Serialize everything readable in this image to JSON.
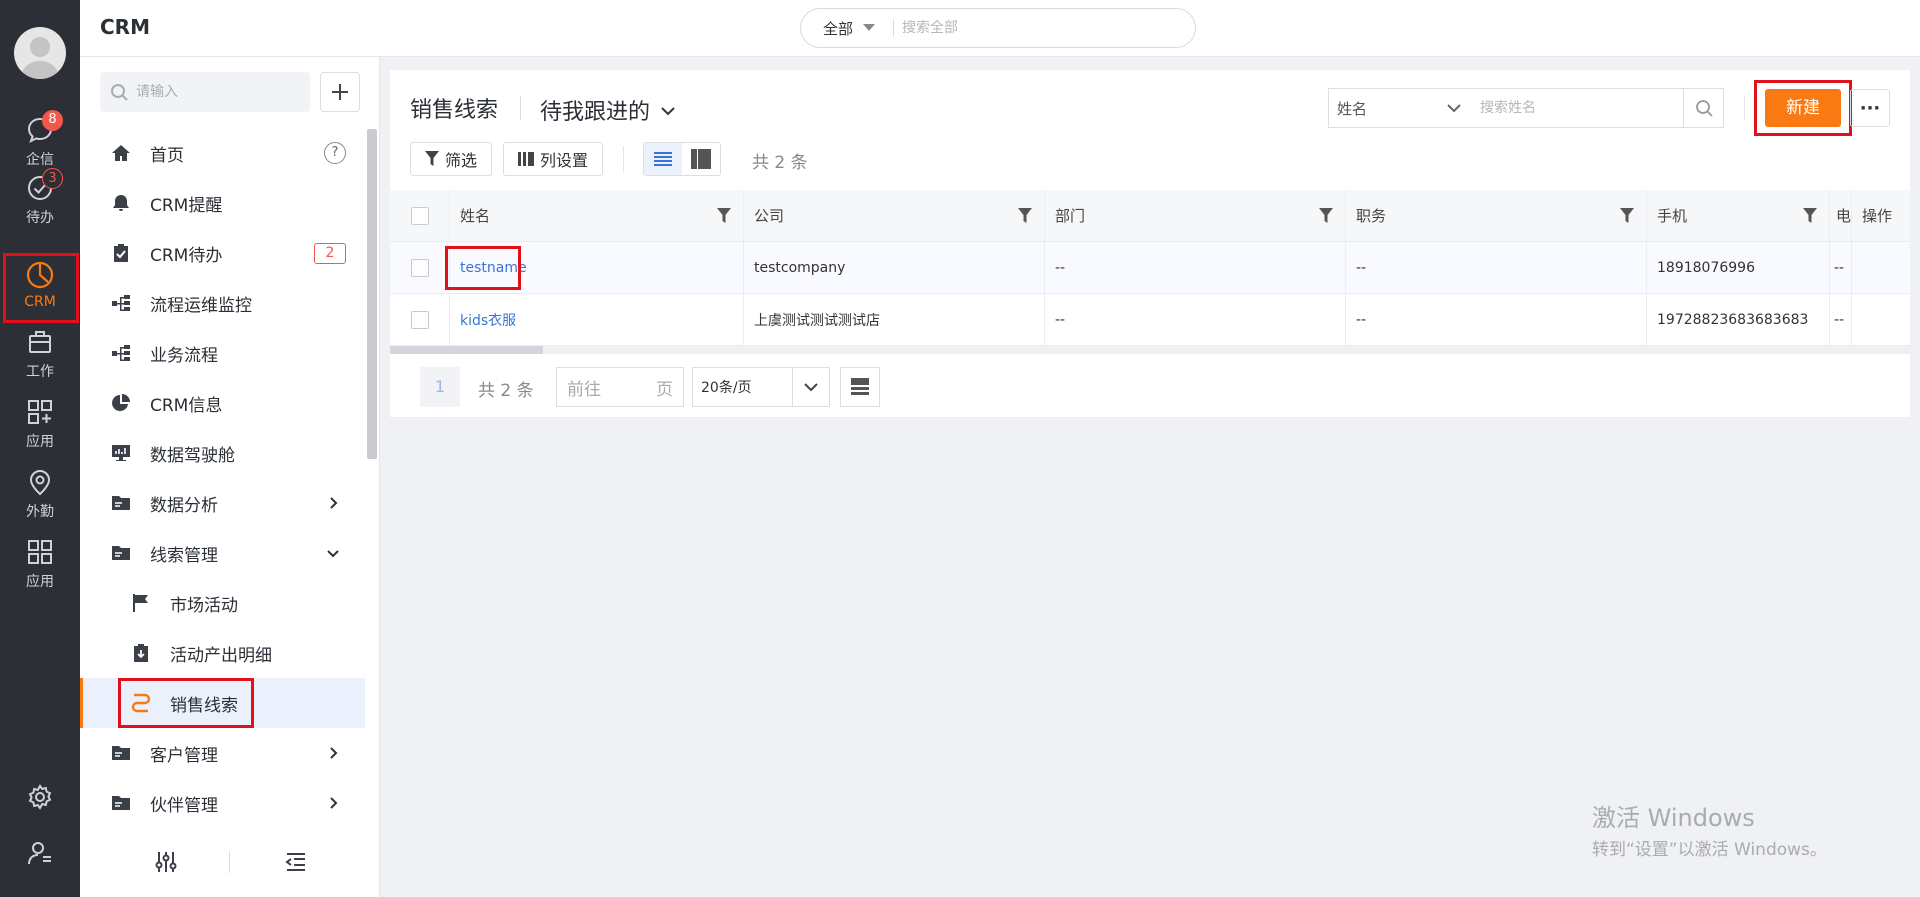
{
  "app": {
    "title": "CRM"
  },
  "global_search": {
    "scope": "全部",
    "placeholder": "搜索全部"
  },
  "rail": {
    "items": [
      {
        "label": "企信",
        "icon": "chat-icon",
        "badge": "8"
      },
      {
        "label": "待办",
        "icon": "check-circle-icon",
        "badge": "3"
      },
      {
        "label": "CRM",
        "icon": "pie-clock-icon",
        "active": true
      },
      {
        "label": "工作",
        "icon": "briefcase-icon"
      },
      {
        "label": "应用",
        "icon": "apps-plus-icon"
      },
      {
        "label": "外勤",
        "icon": "location-pin-icon"
      },
      {
        "label": "应用",
        "icon": "grid-icon"
      }
    ],
    "bottom": [
      "settings-icon",
      "user-settings-icon"
    ]
  },
  "sidenav": {
    "search_placeholder": "请输入",
    "items": [
      {
        "label": "首页",
        "icon": "home-icon",
        "help": "?"
      },
      {
        "label": "CRM提醒",
        "icon": "bell-icon"
      },
      {
        "label": "CRM待办",
        "icon": "clipboard-check-icon",
        "badge": "2"
      },
      {
        "label": "流程运维监控",
        "icon": "flow-icon"
      },
      {
        "label": "业务流程",
        "icon": "flow-icon"
      },
      {
        "label": "CRM信息",
        "icon": "pie-icon"
      },
      {
        "label": "数据驾驶舱",
        "icon": "monitor-icon"
      },
      {
        "label": "数据分析",
        "icon": "folder-icon",
        "chevron": "right"
      },
      {
        "label": "线索管理",
        "icon": "folder-icon",
        "chevron": "down"
      },
      {
        "label": "市场活动",
        "icon": "flag-icon",
        "sub": true
      },
      {
        "label": "活动产出明细",
        "icon": "clipboard-down-icon",
        "sub": true
      },
      {
        "label": "销售线索",
        "icon": "lead-icon",
        "sub": true,
        "active": true
      },
      {
        "label": "客户管理",
        "icon": "folder-icon",
        "chevron": "right"
      },
      {
        "label": "伙伴管理",
        "icon": "folder-icon",
        "chevron": "right"
      }
    ],
    "footer": [
      "sliders-icon",
      "collapse-menu-icon"
    ]
  },
  "main": {
    "title": "销售线索",
    "view": "待我跟进的",
    "search_field": "姓名",
    "search_placeholder": "搜索姓名",
    "new_button": "新建",
    "more_button": "···",
    "filter_button": "筛选",
    "columns_button": "列设置",
    "total": "共 2 条"
  },
  "table": {
    "headers": [
      "姓名",
      "公司",
      "部门",
      "职务",
      "手机",
      "电",
      "操作"
    ],
    "rows": [
      {
        "name": "testname",
        "company": "testcompany",
        "dept": "--",
        "title": "--",
        "mobile": "18918076996",
        "tel": "--"
      },
      {
        "name": "kids衣服",
        "company": "上虞测试测试测试店",
        "dept": "--",
        "title": "--",
        "mobile": "19728823683683683",
        "tel": "--"
      }
    ]
  },
  "pager": {
    "page": "1",
    "total": "共 2 条",
    "goto_prefix": "前往",
    "goto_suffix": "页",
    "page_size": "20条/页"
  },
  "watermark": {
    "line1": "激活 Windows",
    "line2": "转到“设置”以激活 Windows。"
  },
  "colors": {
    "accent": "#f97a12",
    "highlight": "#e0111a",
    "link": "#3a75d6",
    "rail_bg": "#2c2f36"
  }
}
